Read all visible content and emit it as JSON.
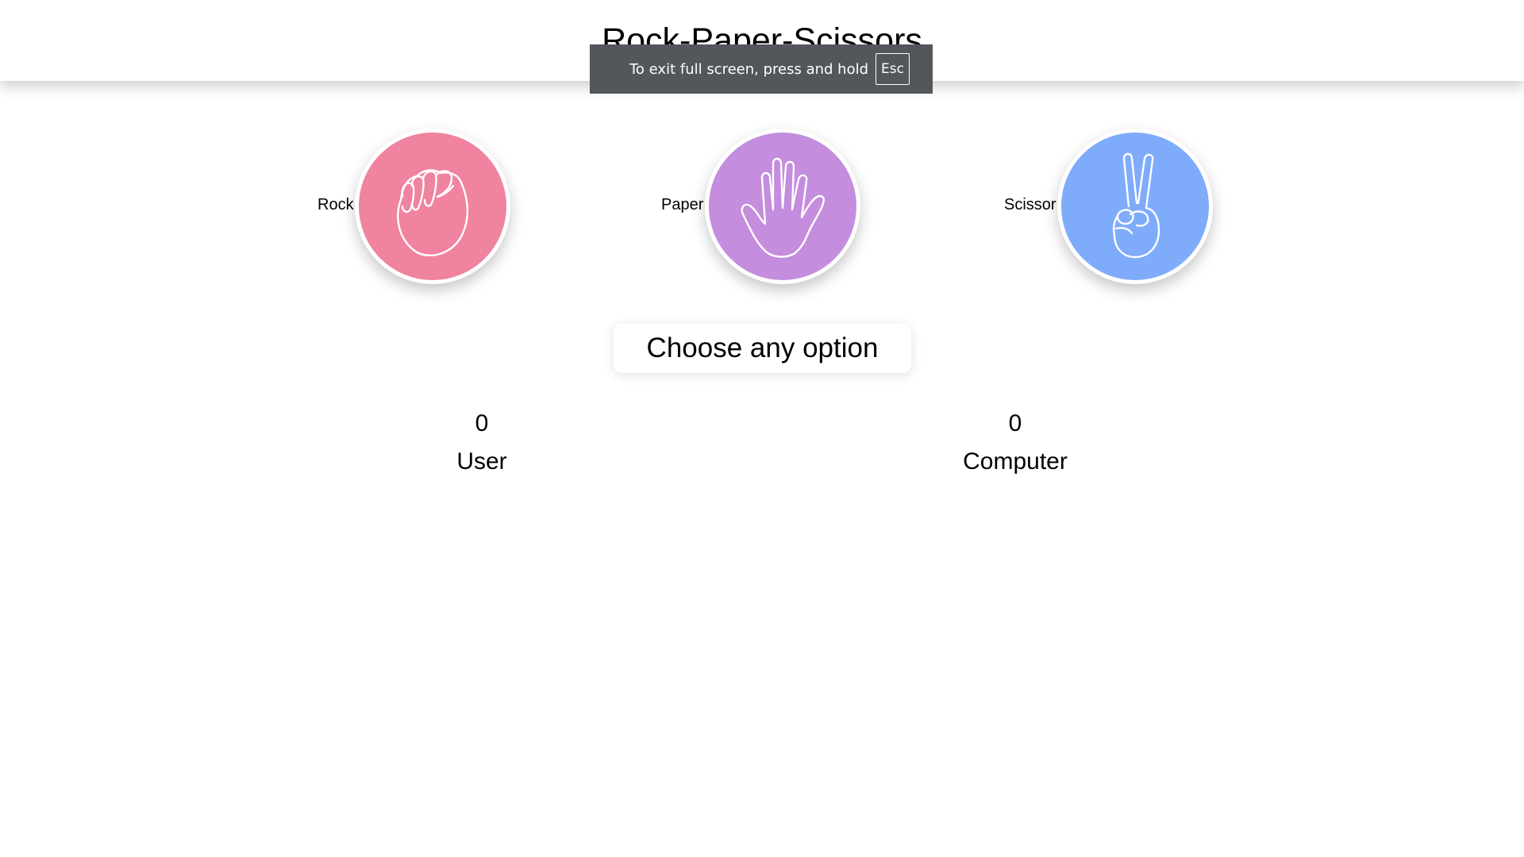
{
  "header": {
    "title": "Rock-Paper-Scissors"
  },
  "fullscreen_notice": {
    "message": "To exit full screen, press and hold",
    "key": "Esc"
  },
  "choices": [
    {
      "label": "Rock",
      "icon": "fist-icon",
      "color": "#f0839f"
    },
    {
      "label": "Paper",
      "icon": "open-hand-icon",
      "color": "#c48ddd"
    },
    {
      "label": "Scissor",
      "icon": "peace-sign-icon",
      "color": "#7fabfb"
    }
  ],
  "message": "Choose any option",
  "scores": {
    "user": {
      "value": "0",
      "label": "User"
    },
    "computer": {
      "value": "0",
      "label": "Computer"
    }
  }
}
